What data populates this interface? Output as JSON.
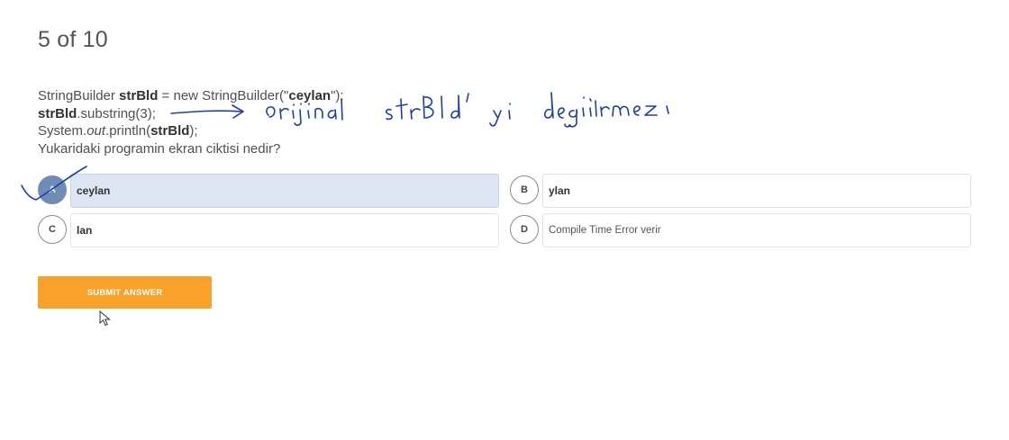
{
  "progress": {
    "label": "5 of 10",
    "current": 5,
    "total": 10
  },
  "question": {
    "line1": {
      "a": "StringBuilder ",
      "b": "strBld",
      "c": " = new StringBuilder(\"",
      "d": "ceylan",
      "e": "\");"
    },
    "line2": {
      "a": "strBld",
      "b": ".substring(3);"
    },
    "line3": {
      "a": "System.",
      "b": "out",
      "c": ".println(",
      "d": "strBld",
      "e": ");"
    },
    "line4": "Yukaridaki programin ekran ciktisi nedir?"
  },
  "options": [
    {
      "letter": "A",
      "text": "ceylan",
      "selected": true
    },
    {
      "letter": "B",
      "text": "ylan",
      "selected": false
    },
    {
      "letter": "C",
      "text": "lan",
      "selected": false
    },
    {
      "letter": "D",
      "text": "Compile Time Error verir",
      "selected": false
    }
  ],
  "submit_label": "SUBMIT ANSWER",
  "annotations": {
    "handwriting": "orijinal strBld'yi değiştirmez",
    "ink_color": "#1f3fa8"
  },
  "colors": {
    "accent": "#f9a12a",
    "selected_badge": "#6f8cb4",
    "selected_fill": "#dfe6f3"
  }
}
